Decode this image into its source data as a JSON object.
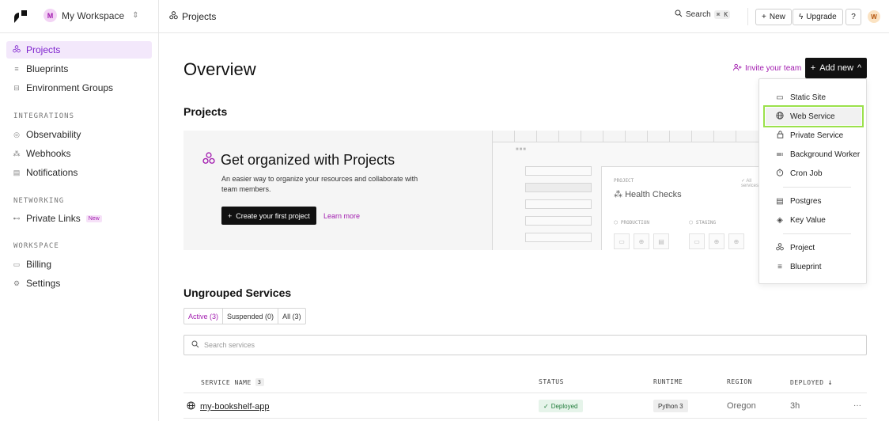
{
  "topbar": {
    "workspace_initial": "M",
    "workspace_name": "My Workspace",
    "breadcrumb": "Projects",
    "search_label": "Search",
    "search_shortcut": "⌘ K",
    "new_label": "New",
    "upgrade_label": "Upgrade",
    "help_label": "?",
    "user_initial": "W"
  },
  "sidebar": {
    "items": [
      {
        "label": "Projects",
        "icon": "projects-icon"
      },
      {
        "label": "Blueprints",
        "icon": "blueprints-icon"
      },
      {
        "label": "Environment Groups",
        "icon": "env-groups-icon"
      }
    ],
    "integrations_head": "INTEGRATIONS",
    "integrations": [
      {
        "label": "Observability"
      },
      {
        "label": "Webhooks"
      },
      {
        "label": "Notifications"
      }
    ],
    "networking_head": "NETWORKING",
    "networking": [
      {
        "label": "Private Links",
        "badge": "New"
      }
    ],
    "workspace_head": "WORKSPACE",
    "workspace": [
      {
        "label": "Billing"
      },
      {
        "label": "Settings"
      }
    ]
  },
  "main": {
    "title": "Overview",
    "invite_label": "Invite your team",
    "add_new_label": "Add new",
    "projects_heading": "Projects",
    "promo": {
      "title": "Get organized with Projects",
      "description": "An easier way to organize your resources and collaborate with team members.",
      "cta": "Create your first project",
      "learn_more": "Learn more",
      "ill_label": "PROJECT",
      "ill_all": "✓ All services",
      "ill_title": "Health Checks",
      "ill_env1": "PRODUCTION",
      "ill_env2": "STAGING"
    },
    "ungrouped_heading": "Ungrouped Services",
    "tabs": [
      {
        "label": "Active (3)",
        "active": true
      },
      {
        "label": "Suspended (0)",
        "active": false
      },
      {
        "label": "All (3)",
        "active": false
      }
    ],
    "search_placeholder": "Search services",
    "table": {
      "headers": {
        "service_name": "SERVICE NAME",
        "service_count": "3",
        "status": "STATUS",
        "runtime": "RUNTIME",
        "region": "REGION",
        "deployed": "DEPLOYED"
      },
      "rows": [
        {
          "name": "my-bookshelf-app",
          "status": "Deployed",
          "runtime": "Python 3",
          "region": "Oregon",
          "deployed": "3h",
          "more": "···"
        }
      ]
    }
  },
  "menu": {
    "items": [
      {
        "label": "Static Site",
        "icon": "static-site-icon"
      },
      {
        "label": "Web Service",
        "icon": "globe-icon"
      },
      {
        "label": "Private Service",
        "icon": "lock-icon"
      },
      {
        "label": "Background Worker",
        "icon": "worker-icon"
      },
      {
        "label": "Cron Job",
        "icon": "clock-icon"
      },
      {
        "label": "Postgres",
        "icon": "database-icon"
      },
      {
        "label": "Key Value",
        "icon": "layers-icon"
      },
      {
        "label": "Project",
        "icon": "projects-icon"
      },
      {
        "label": "Blueprint",
        "icon": "blueprints-icon"
      }
    ]
  },
  "colors": {
    "accent": "#a21caf",
    "active_bg": "#f3e8fb",
    "highlight_outline": "#9be14b",
    "deployed_bg": "#e6f4ea",
    "deployed_fg": "#1e7a38"
  }
}
